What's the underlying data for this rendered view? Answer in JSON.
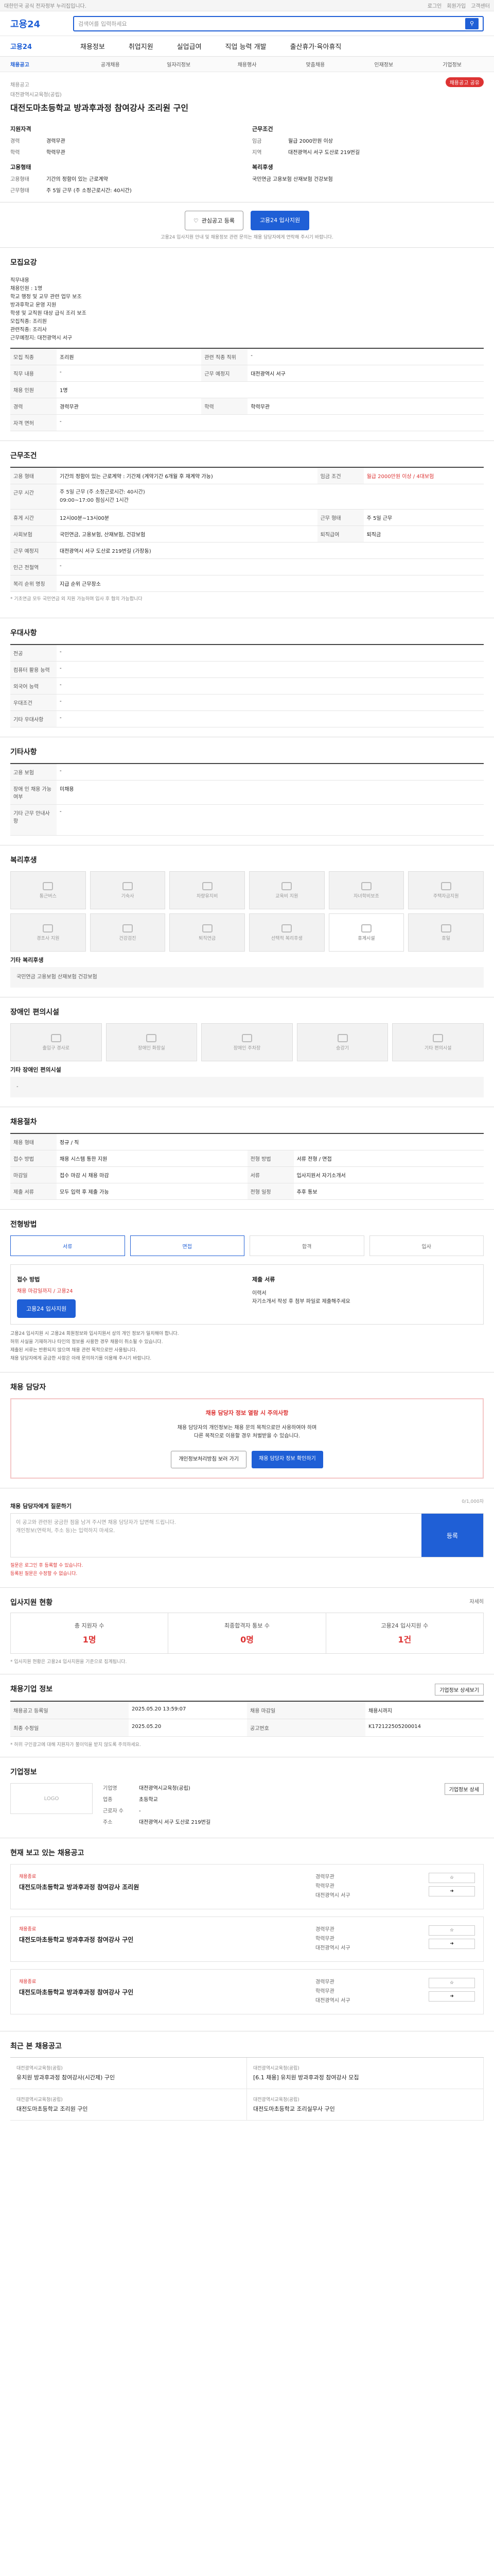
{
  "top": {
    "notice": "대한민국 공식 전자정부 누리집입니다.",
    "links": [
      "로그인",
      "회원가입",
      "고객센터"
    ]
  },
  "header": {
    "logo": "고용24",
    "search_placeholder": "검색어를 입력하세요"
  },
  "gnb": {
    "brand": "고용24",
    "items": [
      "채용정보",
      "취업지원",
      "실업급여",
      "직업 능력 개발",
      "출산휴가·육아휴직"
    ]
  },
  "subnav": [
    "채용공고",
    "공개채용",
    "일자리정보",
    "채용행사",
    "맞춤채용",
    "인재정보",
    "기업정보"
  ],
  "job": {
    "label": "채용공고",
    "share": "채용공고 공유",
    "company_name": "대전광역시교육청(공립)",
    "title": "대전도마초등학교 방과후과정 참여강사 조리원 구인",
    "left_h": "지원자격",
    "left": [
      {
        "k": "경력",
        "v": "경력무관"
      },
      {
        "k": "학력",
        "v": "학력무관"
      }
    ],
    "right_h": "근무조건",
    "right": [
      {
        "k": "임금",
        "v": "월급 2000만원 이상"
      },
      {
        "k": "지역",
        "v": "대전광역시 서구 도산로 219번길"
      }
    ],
    "left2_h": "고용형태",
    "left2": [
      {
        "k": "고용형태",
        "v": "기간의 정함이 있는 근로계약"
      },
      {
        "k": "근무형태",
        "v": "주 5일 근무 (주 소정근로시간: 40시간)"
      }
    ],
    "right2_h": "복리후생",
    "right2": [
      {
        "k": "",
        "v": "국민연금 고용보험 산재보험 건강보험"
      }
    ],
    "btn_scrap": "관심공고 등록",
    "btn_apply": "고용24 입사지원",
    "note": "고용24 입사지원 안내 및 채용정보 관련 문의는 채용 담당자에게 연락해 주시기 바랍니다."
  },
  "s1": {
    "h": "모집요강",
    "pre": "직무내용\n채용인원 : 1명\n학교 행정 및 교무 관련 업무 보조\n방과후학교 운영 지원\n학생 및 교직원 대상 급식 조리 보조\n모집직종: 조리원\n관련직종: 조리사\n근무예정지: 대전광역시 서구",
    "rows": [
      [
        "모집 직종",
        "조리원",
        "관련 직종 직위",
        "-"
      ],
      [
        "직무 내용",
        "-",
        "근무 예정지",
        "대전광역시 서구"
      ],
      [
        "채용 인원",
        "1명",
        "",
        "-"
      ],
      [
        "경력",
        "경력무관",
        "학력",
        "학력무관"
      ],
      [
        "자격 면허",
        "-",
        "",
        ""
      ]
    ]
  },
  "s2": {
    "h": "근무조건",
    "rows": [
      [
        "고용 형태",
        "기간의 정함이 있는 근로계약 : 기간제 (계약기간 6개월 후 재계약 가능)",
        "임금 조건",
        "월급 2000만원 이상 / 4대보험"
      ],
      [
        "근무 시간",
        "주 5일 근무 (주 소정근로시간: 40시간)\n09:00~17:00 점심시간 1시간",
        "",
        ""
      ],
      [
        "휴게 시간",
        "12시00분~13시00분",
        "근무 형태",
        "주 5일 근무"
      ],
      [
        "사회보험",
        "국민연금, 고용보험, 산재보험, 건강보험",
        "퇴직급여",
        "퇴직금"
      ],
      [
        "근무 예정지",
        "대전광역시 서구 도산로 219번길 (가장동)",
        "",
        ""
      ],
      [
        "인근 전철역",
        "-",
        "",
        ""
      ],
      [
        "복리 순위 명칭",
        "지급 순위 근무장소",
        "",
        ""
      ]
    ],
    "footnote": "* 기초연금 모두 국민연금 외 지원 가능하며 입사 후 협의 가능합니다"
  },
  "s3": {
    "h": "우대사항",
    "rows": [
      [
        "전공",
        "-"
      ],
      [
        "컴퓨터 활용 능력",
        "-"
      ],
      [
        "외국어 능력",
        "-"
      ],
      [
        "우대조건",
        "-"
      ],
      [
        "기타 우대사항",
        "-"
      ]
    ]
  },
  "s4": {
    "h": "기타사항",
    "rows": [
      [
        "고용 보험",
        "-"
      ],
      [
        "장애 인 채용 가능 여부",
        "미채용"
      ],
      [
        "기타 근무 안내사항",
        "-"
      ]
    ]
  },
  "s5": {
    "h": "복리후생",
    "cards": [
      "통근버스",
      "기숙사",
      "차량유지비",
      "교육비 지원",
      "자녀학비보조",
      "주택자금지원",
      "경조사 지원",
      "건강검진",
      "퇴직연금",
      "선택적 복리후생",
      "휴게시설",
      "휴일"
    ],
    "extra_h": "기타 복리후생",
    "extra": "국민연금 고용보험 산재보험 건강보험"
  },
  "s6": {
    "h": "장애인 편의시설",
    "cards": [
      "출입구 경사로",
      "장애인 화장실",
      "장애인 주차장",
      "승강기",
      "기타 편의시설"
    ],
    "extra_h": "기타 장애인 편의시설",
    "extra": "-"
  },
  "s7": {
    "h": "채용절차",
    "rows": [
      [
        "채용 형태",
        "정규 / 직"
      ],
      [
        "접수 방법",
        "채용 시스템 통한 지원",
        "전형 방법",
        "서류 전형 / 면접"
      ],
      [
        "마감일",
        "접수 마감 시 채용 마감",
        "서류",
        "입사지원서 자기소개서"
      ],
      [
        "제출 서류",
        "모두 입력 후 제출 가능",
        "전형 일정",
        "추후 통보"
      ]
    ]
  },
  "s8": {
    "h": "전형방법",
    "steps": [
      "서류",
      "면접",
      "합격",
      "입사"
    ],
    "apply_h": "접수 방법",
    "apply_v": "채용 마감일까지 / 고용24",
    "btn": "고용24 입사지원",
    "contact_h": "제출 서류",
    "contact": "이력서\n자기소개서 작성 후 첨부 파일로 제출해주세요",
    "bullets": [
      "고용24 입사지원 시 고용24 회원정보와 입사지원서 상의 개인 정보가 일치해야 합니다.",
      "허위 사실을 기재하거나 타인의 정보를 사용한 경우 채용이 취소될 수 있습니다.",
      "제출된 서류는 반환되지 않으며 채용 관련 목적으로만 사용됩니다.",
      "채용 담당자에게 궁금한 사항은 아래 문의하기를 이용해 주시기 바랍니다."
    ]
  },
  "s9": {
    "h": "채용 담당자",
    "alert_t": "채용 담당자 정보 열람 시 주의사항",
    "alert_b": "채용 담당자의 개인정보는 채용 문의 목적으로만 사용하여야 하며\n다른 목적으로 이용할 경우 처벌받을 수 있습니다.",
    "b1": "개인정보처리방침 보러 가기",
    "b2": "채용 담당자 정보 확인하기"
  },
  "s10": {
    "h": "채용 담당자에게 질문하기",
    "counter": "0/1,000자",
    "placeholder": "이 공고와 관련된 궁금한 점을 남겨 주시면 채용 담당자가 답변해 드립니다.\n개인정보(연락처, 주소 등)는 입력하지 마세요.",
    "send": "등록",
    "notes": [
      "질문은 로그인 후 등록할 수 있습니다.",
      "등록된 질문은 수정할 수 없습니다."
    ]
  },
  "s11": {
    "h": "입사지원 현황",
    "more": "자세히",
    "stats": [
      {
        "k": "총 지원자 수",
        "v": "1명"
      },
      {
        "k": "최종합격자 통보 수",
        "v": "0명"
      },
      {
        "k": "고용24 입사지원 수",
        "v": "1건"
      }
    ],
    "note": "* 입사지원 현황은 고용24 입사지원을 기준으로 집계됩니다."
  },
  "s12": {
    "h": "채용기업 정보",
    "btn": "기업정보 상세보기",
    "rows": [
      [
        "채용공고 등록일",
        "2025.05.20 13:59:07",
        "채용 마감일",
        "채용시까지"
      ],
      [
        "최종 수정일",
        "2025.05.20",
        "공고번호",
        "K172122505200014"
      ]
    ],
    "note": "* 허위 구인광고에 대해 지원자가 불이익을 받지 않도록 주의하세요."
  },
  "s13": {
    "h": "기업정보",
    "btn": "기업정보 상세",
    "rows": [
      [
        "기업명",
        "대전광역시교육청(공립)"
      ],
      [
        "업종",
        "초등학교"
      ],
      [
        "근로자 수",
        "-"
      ],
      [
        "주소",
        "대전광역시 서구 도산로 219번길"
      ]
    ]
  },
  "s14": {
    "h": "현재 보고 있는 채용공고",
    "list": [
      {
        "tag": "채용종료",
        "title": "대전도마초등학교 방과후과정 참여강사 조리원",
        "m": [
          "경력무관",
          "학력무관",
          "대전광역시 서구"
        ]
      },
      {
        "tag": "채용종료",
        "title": "대전도마초등학교 방과후과정 참여강사 구인",
        "m": [
          "경력무관",
          "학력무관",
          "대전광역시 서구"
        ]
      },
      {
        "tag": "채용종료",
        "title": "대전도마초등학교 방과후과정 참여강사 구인",
        "m": [
          "경력무관",
          "학력무관",
          "대전광역시 서구"
        ]
      }
    ]
  },
  "s15": {
    "h": "최근 본 채용공고",
    "items": [
      {
        "s": "대전광역시교육청(공립)",
        "t": "유치원 방과후과정 참여강사(시간제) 구인"
      },
      {
        "s": "대전광역시교육청(공립)",
        "t": "[6.1 채용] 유치원 방과후과정 참여강사 모집"
      },
      {
        "s": "대전광역시교육청(공립)",
        "t": "대전도마초등학교 조리원 구인"
      },
      {
        "s": "대전광역시교육청(공립)",
        "t": "대전도마초등학교 조리실무사 구인"
      }
    ]
  }
}
